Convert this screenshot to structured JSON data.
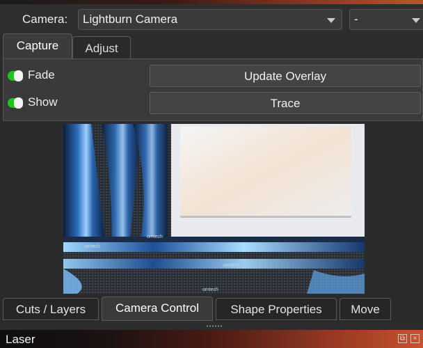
{
  "camera": {
    "label": "Camera:",
    "selected": "Lightburn Camera",
    "secondary_selected": "-"
  },
  "tabs": [
    {
      "label": "Capture",
      "active": true
    },
    {
      "label": "Adjust",
      "active": false
    }
  ],
  "capture": {
    "toggles": [
      {
        "label": "Fade",
        "on": true
      },
      {
        "label": "Show",
        "on": true
      }
    ],
    "update_overlay_label": "Update Overlay",
    "trace_label": "Trace"
  },
  "preview": {
    "watermark": "omtech"
  },
  "bottom_tabs": [
    {
      "label": "Cuts / Layers",
      "active": false
    },
    {
      "label": "Camera Control",
      "active": true
    },
    {
      "label": "Shape Properties",
      "active": false
    },
    {
      "label": "Move",
      "active": false
    }
  ],
  "laser_panel": {
    "title": "Laser",
    "icons": [
      "float-icon",
      "close-icon"
    ]
  },
  "colors": {
    "accent_toggle": "#1fc21f",
    "title_bar_gradient_end": "#c8532c"
  }
}
